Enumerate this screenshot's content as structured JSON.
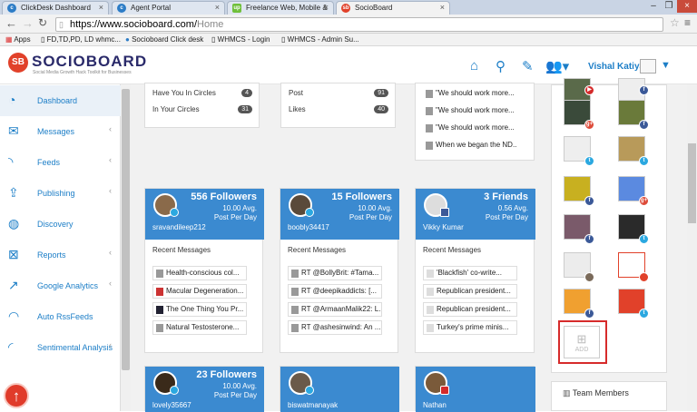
{
  "browser": {
    "tabs": [
      {
        "label": "ClickDesk Dashboard",
        "active": false
      },
      {
        "label": "Agent Portal",
        "active": false
      },
      {
        "label": "Freelance Web, Mobile &",
        "active": false
      },
      {
        "label": "SocioBoard",
        "active": true
      }
    ],
    "url_host": "https://www.socioboard.com/",
    "url_path": "Home",
    "bookmarks": [
      "Apps",
      "FD,TD,PD, LD whmc...",
      "Socioboard Click desk",
      "WHMCS - Login",
      "WHMCS - Admin Su..."
    ]
  },
  "header": {
    "logo_text": "SOCIOBOARD",
    "logo_sub": "Social Media Growth Hack Toolkit for Businesses",
    "logo_badge": "SB",
    "user_name": "Vishal Katiyar"
  },
  "sidebar": {
    "items": [
      {
        "label": "Dashboard",
        "icon": "dashboard-icon"
      },
      {
        "label": "Messages",
        "icon": "envelope-icon"
      },
      {
        "label": "Feeds",
        "icon": "rss-icon"
      },
      {
        "label": "Publishing",
        "icon": "upload-icon"
      },
      {
        "label": "Discovery",
        "icon": "globe-icon"
      },
      {
        "label": "Reports",
        "icon": "excel-icon"
      },
      {
        "label": "Google Analytics",
        "icon": "line-chart-icon"
      },
      {
        "label": "Auto RssFeeds",
        "icon": "wifi-icon"
      },
      {
        "label": "Sentimental Analysis",
        "icon": "signal-icon"
      }
    ]
  },
  "top_cards": {
    "circles": [
      {
        "label": "Have You In Circles",
        "count": "4"
      },
      {
        "label": "In Your Circles",
        "count": "31"
      }
    ],
    "stats": [
      {
        "label": "Post",
        "count": "91"
      },
      {
        "label": "Likes",
        "count": "40"
      }
    ],
    "messages": [
      "\"We should work more...",
      "\"We should work more...",
      "\"We should work more...",
      "When we began the ND..."
    ]
  },
  "profile_cards": [
    {
      "count": "556 Followers",
      "avg": "10.00 Avg.",
      "ppd": "Post Per Day",
      "name": "sravandileep212",
      "network": "twitter",
      "recent_label": "Recent Messages",
      "messages": [
        "Health-conscious col...",
        "Macular Degeneration...",
        "The One Thing You Pr...",
        "Natural Testosterone..."
      ]
    },
    {
      "count": "15 Followers",
      "avg": "10.00 Avg.",
      "ppd": "Post Per Day",
      "name": "boobly34417",
      "network": "twitter",
      "recent_label": "Recent Messages",
      "messages": [
        "RT @BollyBrit: #Tama...",
        "RT @deepikaddicts: [...",
        "RT @ArmaanMalik22: L...",
        "RT @ashesinwind: An ..."
      ]
    },
    {
      "count": "3 Friends",
      "avg": "0.56 Avg.",
      "ppd": "Post Per Day",
      "name": "Vikky Kumar",
      "network": "facebook",
      "recent_label": "Recent Messages",
      "messages": [
        "'Blackfish' co-write...",
        "Republican president...",
        "Republican president...",
        "Turkey's prime minis..."
      ]
    },
    {
      "count": "23 Followers",
      "avg": "10.00 Avg.",
      "ppd": "Post Per Day",
      "name": "lovely35667",
      "network": "twitter"
    },
    {
      "name": "biswatmanayak",
      "network": "twitter"
    },
    {
      "name": "Nathan",
      "network": "youtube"
    }
  ],
  "profiles_panel": {
    "add_label": "ADD",
    "team_label": "Team Members"
  },
  "colors": {
    "accent": "#1c7ec7",
    "card_header": "#3b8ad0",
    "logo": "#e1412a"
  }
}
